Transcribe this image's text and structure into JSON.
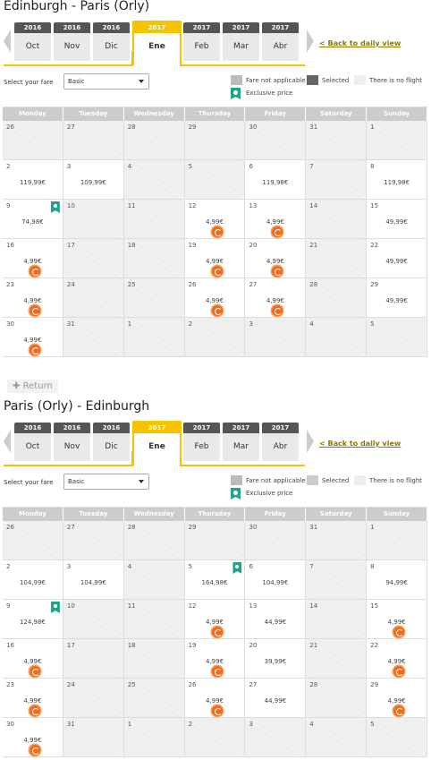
{
  "outbound": {
    "title": "Edinburgh - Paris (Orly)",
    "months": [
      {
        "year": "2016",
        "month": "Oct"
      },
      {
        "year": "2016",
        "month": "Nov"
      },
      {
        "year": "2016",
        "month": "Dic"
      },
      {
        "year": "2017",
        "month": "Ene",
        "selected": true
      },
      {
        "year": "2017",
        "month": "Feb"
      },
      {
        "year": "2017",
        "month": "Mar"
      },
      {
        "year": "2017",
        "month": "Abr"
      }
    ],
    "back_link": "< Back to daily view",
    "select_label": "Select your fare",
    "select_value": "Basic",
    "legend": {
      "fare_na": "Fare not applicable",
      "selected": "Selected",
      "no_flight": "There is no flight",
      "exclusive": "Exclusive price"
    },
    "days": [
      "Monday",
      "Tuesday",
      "Wednesday",
      "Thursday",
      "Friday",
      "Saturday",
      "Sunday"
    ],
    "weeks": [
      [
        {
          "d": "26",
          "na": true
        },
        {
          "d": "27",
          "na": true
        },
        {
          "d": "28",
          "na": true
        },
        {
          "d": "29",
          "na": true
        },
        {
          "d": "30",
          "na": true
        },
        {
          "d": "31",
          "na": true
        },
        {
          "d": "1",
          "na": true
        }
      ],
      [
        {
          "d": "2",
          "p": "119,99€"
        },
        {
          "d": "3",
          "p": "109,99€"
        },
        {
          "d": "4",
          "na": true
        },
        {
          "d": "5",
          "na": true
        },
        {
          "d": "6",
          "p": "119,98€"
        },
        {
          "d": "7",
          "na": true
        },
        {
          "d": "8",
          "p": "119,98€"
        }
      ],
      [
        {
          "d": "9",
          "p": "74,98€",
          "ex": true
        },
        {
          "d": "10",
          "na": true
        },
        {
          "d": "11",
          "na": true
        },
        {
          "d": "12",
          "p": "4,99€",
          "b": true
        },
        {
          "d": "13",
          "p": "4,99€",
          "b": true
        },
        {
          "d": "14",
          "na": true
        },
        {
          "d": "15",
          "p": "49,99€"
        }
      ],
      [
        {
          "d": "16",
          "p": "4,99€",
          "b": true
        },
        {
          "d": "17",
          "na": true
        },
        {
          "d": "18",
          "na": true
        },
        {
          "d": "19",
          "p": "4,99€",
          "b": true
        },
        {
          "d": "20",
          "p": "4,99€",
          "b": true
        },
        {
          "d": "21",
          "na": true
        },
        {
          "d": "22",
          "p": "49,99€"
        }
      ],
      [
        {
          "d": "23",
          "p": "4,99€",
          "b": true
        },
        {
          "d": "24",
          "na": true
        },
        {
          "d": "25",
          "na": true
        },
        {
          "d": "26",
          "p": "4,99€",
          "b": true
        },
        {
          "d": "27",
          "p": "4,99€",
          "b": true
        },
        {
          "d": "28",
          "na": true
        },
        {
          "d": "29",
          "p": "49,99€"
        }
      ],
      [
        {
          "d": "30",
          "p": "4,99€",
          "b": true
        },
        {
          "d": "31",
          "na": true
        },
        {
          "d": "1",
          "na": true
        },
        {
          "d": "2",
          "na": true
        },
        {
          "d": "3",
          "na": true
        },
        {
          "d": "4",
          "na": true
        },
        {
          "d": "5",
          "na": true
        }
      ]
    ]
  },
  "return_button": "Return",
  "inbound": {
    "title": "Paris (Orly) - Edinburgh",
    "months": [
      {
        "year": "2016",
        "month": "Oct"
      },
      {
        "year": "2016",
        "month": "Nov"
      },
      {
        "year": "2016",
        "month": "Dic"
      },
      {
        "year": "2017",
        "month": "Ene",
        "selected": true
      },
      {
        "year": "2017",
        "month": "Feb"
      },
      {
        "year": "2017",
        "month": "Mar"
      },
      {
        "year": "2017",
        "month": "Abr"
      }
    ],
    "back_link": "< Back to daily view",
    "select_label": "Select your fare",
    "select_value": "Basic",
    "legend": {
      "fare_na": "Fare not applicable",
      "selected": "Selected",
      "no_flight": "There is no flight",
      "exclusive": "Exclusive price"
    },
    "days": [
      "Monday",
      "Tuesday",
      "Wednesday",
      "Thursday",
      "Friday",
      "Saturday",
      "Sunday"
    ],
    "weeks": [
      [
        {
          "d": "26",
          "na": true
        },
        {
          "d": "27",
          "na": true
        },
        {
          "d": "28",
          "na": true
        },
        {
          "d": "29",
          "na": true
        },
        {
          "d": "30",
          "na": true
        },
        {
          "d": "31",
          "na": true
        },
        {
          "d": "1",
          "na": true
        }
      ],
      [
        {
          "d": "2",
          "p": "104,99€"
        },
        {
          "d": "3",
          "p": "104,99€"
        },
        {
          "d": "4",
          "na": true
        },
        {
          "d": "5",
          "p": "164,98€",
          "ex": true
        },
        {
          "d": "6",
          "p": "104,99€"
        },
        {
          "d": "7",
          "na": true
        },
        {
          "d": "8",
          "p": "94,99€"
        }
      ],
      [
        {
          "d": "9",
          "p": "124,98€",
          "ex": true
        },
        {
          "d": "10",
          "na": true
        },
        {
          "d": "11",
          "na": true
        },
        {
          "d": "12",
          "p": "4,99€",
          "b": true
        },
        {
          "d": "13",
          "p": "44,99€"
        },
        {
          "d": "14",
          "na": true
        },
        {
          "d": "15",
          "p": "4,99€",
          "b": true
        }
      ],
      [
        {
          "d": "16",
          "p": "4,99€",
          "b": true
        },
        {
          "d": "17",
          "na": true
        },
        {
          "d": "18",
          "na": true
        },
        {
          "d": "19",
          "p": "4,99€",
          "b": true
        },
        {
          "d": "20",
          "p": "39,99€"
        },
        {
          "d": "21",
          "na": true
        },
        {
          "d": "22",
          "p": "4,99€",
          "b": true
        }
      ],
      [
        {
          "d": "23",
          "p": "4,99€",
          "b": true
        },
        {
          "d": "24",
          "na": true
        },
        {
          "d": "25",
          "na": true
        },
        {
          "d": "26",
          "p": "4,99€",
          "b": true
        },
        {
          "d": "27",
          "p": "44,99€"
        },
        {
          "d": "28",
          "na": true
        },
        {
          "d": "29",
          "p": "4,99€",
          "b": true
        }
      ],
      [
        {
          "d": "30",
          "p": "4,99€",
          "b": true
        },
        {
          "d": "31",
          "na": true
        },
        {
          "d": "1",
          "na": true
        },
        {
          "d": "2",
          "na": true
        },
        {
          "d": "3",
          "na": true
        },
        {
          "d": "4",
          "na": true
        },
        {
          "d": "5",
          "na": true
        }
      ]
    ]
  }
}
